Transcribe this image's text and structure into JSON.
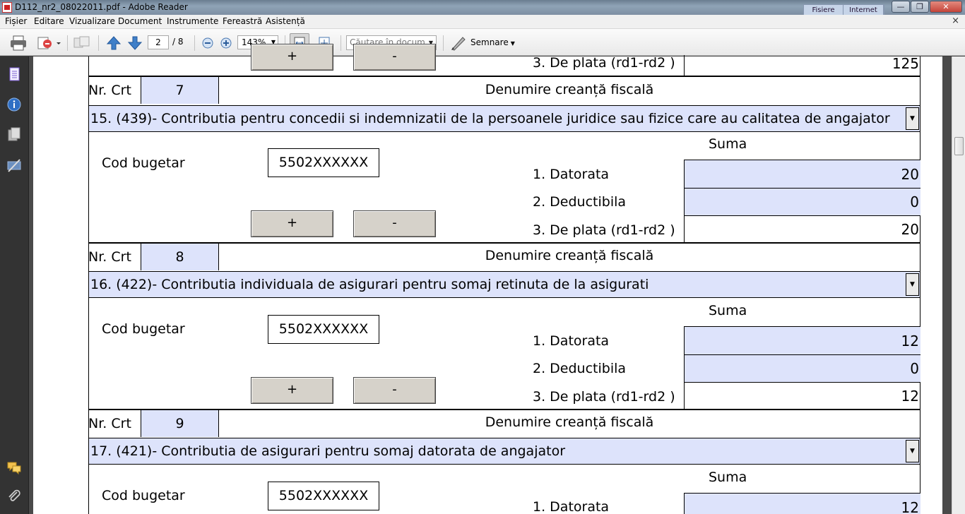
{
  "window": {
    "title": "D112_nr2_08022011.pdf - Adobe Reader",
    "tabs": [
      "Fisiere",
      "Internet"
    ],
    "controls": {
      "minimize": "—",
      "maximize": "❐",
      "close": "✕"
    }
  },
  "menu": {
    "items": [
      "Fișier",
      "Editare",
      "Vizualizare",
      "Document",
      "Instrumente",
      "Fereastră",
      "Asistență"
    ],
    "close": "×"
  },
  "toolbar": {
    "current_page": "2",
    "total_pages": "/ 8",
    "zoom": "143%",
    "search_placeholder": "Căutare în docum...",
    "sign_label": "Semnare",
    "icons": [
      "print-icon",
      "share-icon",
      "collaborate-icon",
      "prev-page-icon",
      "next-page-icon",
      "zoom-out-icon",
      "zoom-in-icon",
      "fit-width-icon",
      "fit-page-icon",
      "sign-pen-icon"
    ]
  },
  "left_nav": {
    "icons": [
      "pages-icon",
      "info-icon",
      "attachments-pages-icon",
      "signature-icon",
      "comments-icon",
      "attachment-clip-icon"
    ]
  },
  "form": {
    "prev_block": {
      "row3_label": "3. De plata (rd1-rd2 )",
      "row3_value": "125",
      "plus": "+",
      "minus": "-"
    },
    "blocks": [
      {
        "nr_label": "Nr. Crt",
        "nr": "7",
        "denumire_label": "Denumire creanță fiscală",
        "title": "15. (439)- Contributia pentru concedii si indemnizatii de la persoanele juridice sau fizice care au calitatea de angajator",
        "cod_label": "Cod bugetar",
        "cod": "5502XXXXXX",
        "suma_label": "Suma",
        "rows": [
          {
            "label": "1. Datorata",
            "value": "20"
          },
          {
            "label": "2. Deductibila",
            "value": "0"
          },
          {
            "label": "3. De plata (rd1-rd2 )",
            "value": "20"
          }
        ],
        "plus": "+",
        "minus": "-"
      },
      {
        "nr_label": "Nr. Crt",
        "nr": "8",
        "denumire_label": "Denumire creanță fiscală",
        "title": "16. (422)- Contributia individuala de asigurari pentru somaj retinuta de la asigurati",
        "cod_label": "Cod bugetar",
        "cod": "5502XXXXXX",
        "suma_label": "Suma",
        "rows": [
          {
            "label": "1. Datorata",
            "value": "12"
          },
          {
            "label": "2. Deductibila",
            "value": "0"
          },
          {
            "label": "3. De plata (rd1-rd2 )",
            "value": "12"
          }
        ],
        "plus": "+",
        "minus": "-"
      },
      {
        "nr_label": "Nr. Crt",
        "nr": "9",
        "denumire_label": "Denumire creanță fiscală",
        "title": "17. (421)- Contributia de asigurari pentru somaj datorata de angajator",
        "cod_label": "Cod bugetar",
        "cod": "5502XXXXXX",
        "suma_label": "Suma",
        "rows": [
          {
            "label": "1. Datorata",
            "value": "12"
          }
        ]
      }
    ]
  },
  "colors": {
    "field_fill": "#dde3fb",
    "button_fill": "#d6d2ca",
    "panel_dark": "#333333"
  }
}
